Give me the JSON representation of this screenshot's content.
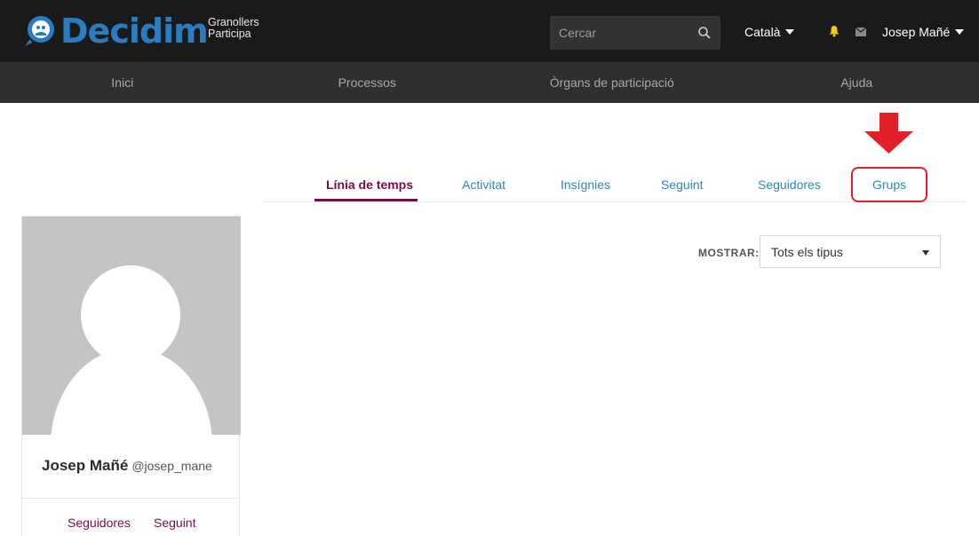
{
  "header": {
    "logo_text": "Decidim",
    "org_line1": "Granollers",
    "org_line2": "Participa",
    "search_placeholder": "Cercar",
    "language": "Català",
    "user_name": "Josep Mañé"
  },
  "nav": {
    "items": [
      "Inici",
      "Processos",
      "Òrgans de participació",
      "Ajuda"
    ]
  },
  "tabs": {
    "items": [
      "Línia de temps",
      "Activitat",
      "Insígnies",
      "Seguint",
      "Seguidores",
      "Grups"
    ],
    "active": "Línia de temps"
  },
  "profile": {
    "name": "Josep Mañé",
    "nickname": "@josep_mane",
    "followers_label": "Seguidores",
    "following_label": "Seguint"
  },
  "filter": {
    "label": "MOSTRAR:",
    "selected": "Tots els tipus"
  },
  "colors": {
    "accent": "#7a0c4a",
    "link": "#2a8ab7",
    "logo": "#2b7bc0",
    "annotation": "#e0202a",
    "topbar": "#1a1a1a",
    "nav": "#2f2f2f"
  }
}
